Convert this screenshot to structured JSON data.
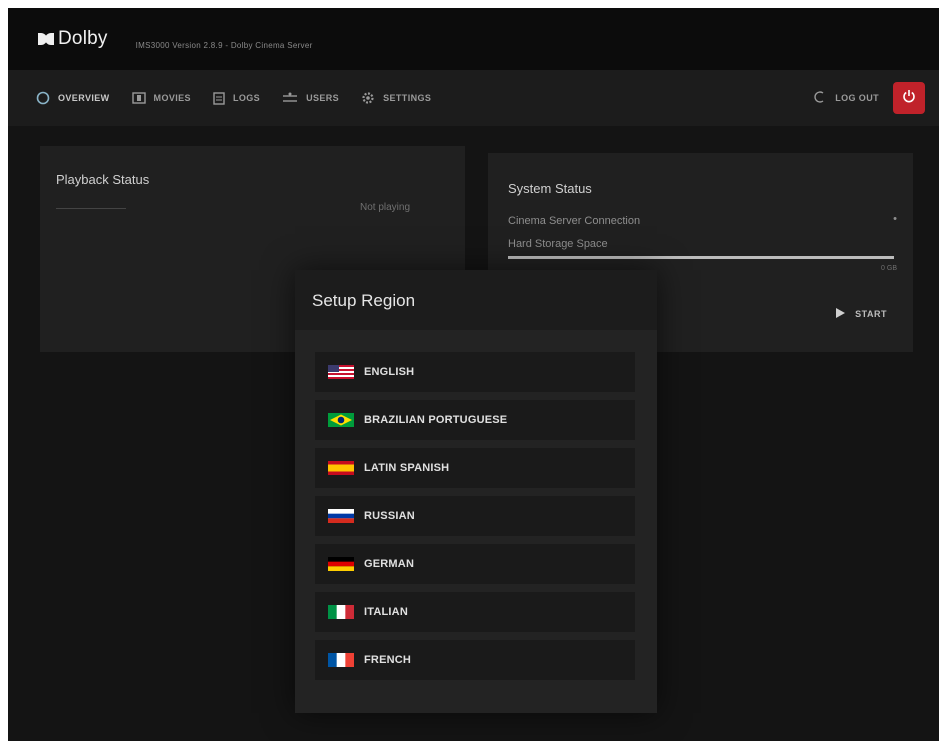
{
  "app": {
    "brand": "Dolby",
    "subtitle": "IMS3000 Version 2.8.9 - Dolby Cinema Server"
  },
  "nav": {
    "items": [
      {
        "label": "OVERVIEW",
        "icon": "circle-icon"
      },
      {
        "label": "MOVIES",
        "icon": "film-icon"
      },
      {
        "label": "LOGS",
        "icon": "document-icon"
      },
      {
        "label": "USERS",
        "icon": "users-icon"
      },
      {
        "label": "SETTINGS",
        "icon": "gear-icon"
      }
    ],
    "logout_label": "LOG OUT"
  },
  "playback": {
    "title": "Playback Status",
    "status": "Not playing"
  },
  "system": {
    "title": "System Status",
    "row1": "Cinema Server Connection",
    "row2": "Hard Storage Space",
    "storage_fraction": 1.0,
    "storage_value": "0 GB",
    "start_label": "START"
  },
  "modal": {
    "title": "Setup Region",
    "languages": [
      {
        "label": "ENGLISH",
        "flag": "us-flag"
      },
      {
        "label": "BRAZILIAN PORTUGUESE",
        "flag": "brazil-flag"
      },
      {
        "label": "LATIN SPANISH",
        "flag": "spain-flag"
      },
      {
        "label": "RUSSIAN",
        "flag": "russia-flag"
      },
      {
        "label": "GERMAN",
        "flag": "germany-flag"
      },
      {
        "label": "ITALIAN",
        "flag": "italy-flag"
      },
      {
        "label": "FRENCH",
        "flag": "france-flag"
      }
    ]
  },
  "colors": {
    "background": "#141414",
    "accent_red": "#c0222a"
  }
}
